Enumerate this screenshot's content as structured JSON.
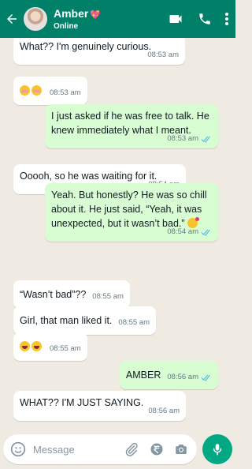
{
  "header": {
    "name": "Amber",
    "status": "Online"
  },
  "composer": {
    "placeholder": "Message"
  },
  "messages": [
    {
      "dir": "in",
      "text": "What?? I'm genuinely curious.",
      "time": "08:53 am"
    },
    {
      "dir": "in",
      "text": "",
      "emojis": [
        "flushed-emoji",
        "flushed-emoji"
      ],
      "time": "08:53 am"
    },
    {
      "dir": "out",
      "text": "I just asked if he was free to talk. He knew immediately what I meant.",
      "time": "08:53 am",
      "read": true
    },
    {
      "dir": "in",
      "text": "Ooooh, so he was waiting for it.",
      "time": "08:54 am"
    },
    {
      "dir": "out",
      "text": "Yeah. But honestly? He was so chill about it. He just said, “Yeah, it was unexpected, but it wasn’t bad.”",
      "emojis": [
        "kissing-emoji"
      ],
      "time": "08:54 am",
      "read": true
    },
    {
      "dir": "in",
      "text": "“Wasn’t bad”??",
      "time": "08:55 am"
    },
    {
      "dir": "in",
      "text": "Girl, that man liked it.",
      "time": "08:55 am"
    },
    {
      "dir": "in",
      "text": "",
      "emojis": [
        "laughing-emoji",
        "laughing-emoji"
      ],
      "time": "08:55 am"
    },
    {
      "dir": "out",
      "text": "AMBER",
      "time": "08:56 am",
      "read": true
    },
    {
      "dir": "in",
      "text": "WHAT?? I'M JUST SAYING.",
      "time": "08:56 am"
    }
  ],
  "colors": {
    "header": "#008069",
    "chat_bg": "#efeae2",
    "incoming": "#ffffff",
    "outgoing": "#d9fdd3",
    "read_ticks": "#53bdeb",
    "mic": "#00a884"
  }
}
